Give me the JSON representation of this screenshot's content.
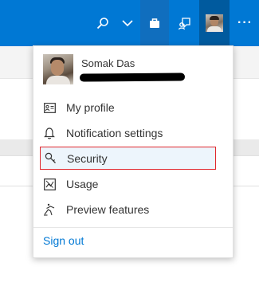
{
  "header": {
    "icons": [
      "search-icon",
      "chevron-down-icon",
      "briefcase-icon",
      "feedback-icon",
      "avatar",
      "more-icon"
    ],
    "more_label": "···"
  },
  "account_menu": {
    "user_name": "Somak Das",
    "items": [
      {
        "label": "My profile",
        "icon": "profile-card-icon"
      },
      {
        "label": "Notification settings",
        "icon": "bell-icon"
      },
      {
        "label": "Security",
        "icon": "key-icon",
        "selected": true
      },
      {
        "label": "Usage",
        "icon": "usage-icon"
      },
      {
        "label": "Preview features",
        "icon": "preview-features-icon"
      }
    ],
    "sign_out": "Sign out"
  },
  "colors": {
    "accent": "#0078d4",
    "selection_border": "#e0282e"
  }
}
